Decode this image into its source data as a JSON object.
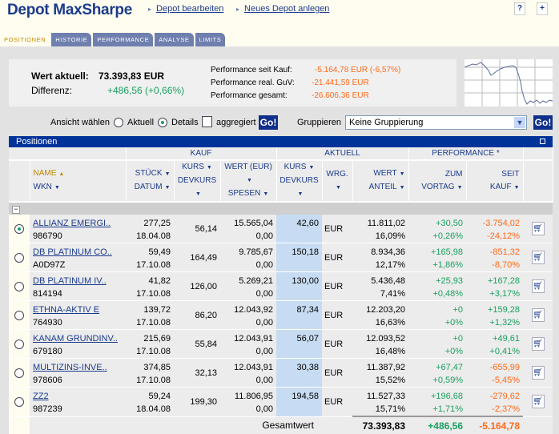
{
  "header": {
    "title": "Depot MaxSharpe",
    "links": [
      "Depot bearbeiten",
      "Neues Depot anlegen"
    ],
    "help_icon": "?",
    "new_icon": "+"
  },
  "tabs": [
    "POSITIONEN",
    "HISTORIE",
    "PERFORMANCE",
    "ANALYSE",
    "LIMITS"
  ],
  "summary": {
    "wert_label": "Wert aktuell:",
    "wert_value": "73.393,83 EUR",
    "diff_label": "Differenz:",
    "diff_value": "+486,56 (+0,66%)",
    "perf": [
      {
        "label": "Performance seit Kauf:",
        "value": "-5.164,78 EUR (-6,57%)"
      },
      {
        "label": "Performance real. GuV:",
        "value": "-21.441,59 EUR"
      },
      {
        "label": "Performance gesamt:",
        "value": "-26.606,36 EUR"
      }
    ]
  },
  "view": {
    "label": "Ansicht wählen",
    "aktuell": "Aktuell",
    "details": "Details",
    "aggregiert": "aggregiert",
    "go": "Go!",
    "group_label": "Gruppieren",
    "group_value": "Keine Gruppierung"
  },
  "panel": {
    "title": "Positionen",
    "groups": [
      "KAUF",
      "AKTUELL",
      "PERFORMANCE *"
    ],
    "cols": {
      "name": "NAME",
      "wkn": "WKN",
      "stueck": "STÜCK",
      "datum": "DATUM",
      "kurs": "KURS",
      "devkurs": "DEVKURS",
      "wert": "WERT (EUR)",
      "spesen": "SPESEN",
      "wrg": "WRG.",
      "wert2": "WERT",
      "anteil": "ANTEIL",
      "zum": "ZUM",
      "vortag": "VORTAG",
      "seit": "SEIT",
      "kauf": "KAUF"
    },
    "collapse": "−"
  },
  "rows": [
    {
      "name": "ALLIANZ EMERGI..",
      "wkn": "986790",
      "stueck": "277,25",
      "datum": "18.04.08",
      "kurs": "56,14",
      "wert": "15.565,04",
      "spesen": "0,00",
      "akurs": "42,60",
      "wrg": "EUR",
      "wert2": "11.811,02",
      "anteil": "16,09%",
      "vt": "+30,50",
      "vtp": "+0,26%",
      "sk": "-3.754,02",
      "skp": "-24,12%",
      "selected": true
    },
    {
      "name": "DB PLATINUM CO..",
      "wkn": "A0D97Z",
      "stueck": "59,49",
      "datum": "17.10.08",
      "kurs": "164,49",
      "wert": "9.785,67",
      "spesen": "0,00",
      "akurs": "150,18",
      "wrg": "EUR",
      "wert2": "8.934,36",
      "anteil": "12,17%",
      "vt": "+165,98",
      "vtp": "+1,86%",
      "sk": "-851,32",
      "skp": "-8,70%"
    },
    {
      "name": "DB PLATINUM IV..",
      "wkn": "814194",
      "stueck": "41,82",
      "datum": "17.10.08",
      "kurs": "126,00",
      "wert": "5.269,21",
      "spesen": "0,00",
      "akurs": "130,00",
      "wrg": "EUR",
      "wert2": "5.436,48",
      "anteil": "7,41%",
      "vt": "+25,93",
      "vtp": "+0,48%",
      "sk": "+167,28",
      "skp": "+3,17%"
    },
    {
      "name": "ETHNA-AKTIV E",
      "wkn": "764930",
      "stueck": "139,72",
      "datum": "17.10.08",
      "kurs": "86,20",
      "wert": "12.043,92",
      "spesen": "0,00",
      "akurs": "87,34",
      "wrg": "EUR",
      "wert2": "12.203,20",
      "anteil": "16,63%",
      "vt": "+0",
      "vtp": "+0%",
      "sk": "+159,28",
      "skp": "+1,32%"
    },
    {
      "name": "KANAM GRUNDINV..",
      "wkn": "679180",
      "stueck": "215,69",
      "datum": "17.10.08",
      "kurs": "55,84",
      "wert": "12.043,91",
      "spesen": "0,00",
      "akurs": "56,07",
      "wrg": "EUR",
      "wert2": "12.093,52",
      "anteil": "16,48%",
      "vt": "+0",
      "vtp": "+0%",
      "sk": "+49,61",
      "skp": "+0,41%"
    },
    {
      "name": "MULTIZINS-INVE..",
      "wkn": "978606",
      "stueck": "374,85",
      "datum": "17.10.08",
      "kurs": "32,13",
      "wert": "12.043,91",
      "spesen": "0,00",
      "akurs": "30,38",
      "wrg": "EUR",
      "wert2": "11.387,92",
      "anteil": "15,52%",
      "vt": "+67,47",
      "vtp": "+0,59%",
      "sk": "-655,99",
      "skp": "-5,45%"
    },
    {
      "name": "ZZ2",
      "wkn": "987239",
      "stueck": "59,24",
      "datum": "18.04.08",
      "kurs": "199,30",
      "wert": "11.806,95",
      "spesen": "0,00",
      "akurs": "194,58",
      "wrg": "EUR",
      "wert2": "11.527,33",
      "anteil": "15,71%",
      "vt": "+196,68",
      "vtp": "+1,71%",
      "sk": "-279,62",
      "skp": "-2,37%"
    }
  ],
  "total": {
    "label": "Gesamtwert",
    "wert": "73.393,83",
    "vortag": "+486,56",
    "kauf": "-5.164,78"
  },
  "colors": {
    "brand": "#1a3a8c",
    "bar": "#00339a",
    "pos": "#1aa060",
    "neg": "#ff6a1a"
  }
}
